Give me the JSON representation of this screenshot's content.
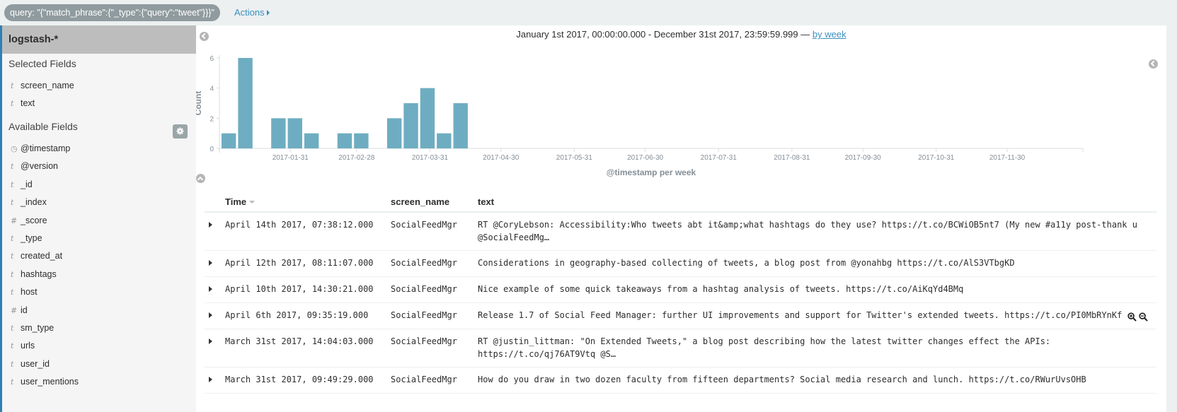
{
  "topbar": {
    "query_filter": "query: \"{\"match_phrase\":{\"_type\":{\"query\":\"tweet\"}}}\"",
    "actions_label": "Actions"
  },
  "sidebar": {
    "index_pattern": "logstash-*",
    "selected_title": "Selected Fields",
    "selected_fields": [
      {
        "type": "t",
        "name": "screen_name"
      },
      {
        "type": "t",
        "name": "text"
      }
    ],
    "available_title": "Available Fields",
    "available_fields": [
      {
        "type": "clock",
        "name": "@timestamp"
      },
      {
        "type": "t",
        "name": "@version"
      },
      {
        "type": "t",
        "name": "_id"
      },
      {
        "type": "t",
        "name": "_index"
      },
      {
        "type": "#",
        "name": "_score"
      },
      {
        "type": "t",
        "name": "_type"
      },
      {
        "type": "t",
        "name": "created_at"
      },
      {
        "type": "t",
        "name": "hashtags"
      },
      {
        "type": "t",
        "name": "host"
      },
      {
        "type": "#",
        "name": "id"
      },
      {
        "type": "t",
        "name": "sm_type"
      },
      {
        "type": "t",
        "name": "urls"
      },
      {
        "type": "t",
        "name": "user_id"
      },
      {
        "type": "t",
        "name": "user_mentions"
      }
    ]
  },
  "histogram": {
    "range_text": "January 1st 2017, 00:00:00.000 - December 31st 2017, 23:59:59.999 —",
    "interval_link": "by week"
  },
  "chart_data": {
    "type": "bar",
    "title": "",
    "xlabel": "@timestamp per week",
    "ylabel": "Count",
    "ylim": [
      0,
      6
    ],
    "yticks": [
      0,
      2,
      4,
      6
    ],
    "xrange": [
      "2017-01-01",
      "2017-12-31"
    ],
    "xtick_labels": [
      "2017-01-31",
      "2017-02-28",
      "2017-03-31",
      "2017-04-30",
      "2017-05-31",
      "2017-06-30",
      "2017-07-31",
      "2017-08-31",
      "2017-09-30",
      "2017-10-31",
      "2017-11-30"
    ],
    "categories": [
      "2017-01-01",
      "2017-01-08",
      "2017-01-15",
      "2017-01-22",
      "2017-01-29",
      "2017-02-05",
      "2017-02-12",
      "2017-02-19",
      "2017-02-26",
      "2017-03-05",
      "2017-03-12",
      "2017-03-19",
      "2017-03-26",
      "2017-04-02",
      "2017-04-09"
    ],
    "values": [
      1,
      6,
      0,
      2,
      2,
      1,
      0,
      1,
      1,
      0,
      2,
      3,
      4,
      1,
      3
    ],
    "bar_color": "#6eadc1",
    "grid": false
  },
  "table": {
    "columns": [
      "Time",
      "screen_name",
      "text"
    ],
    "rows": [
      {
        "time": "April 14th 2017, 07:38:12.000",
        "screen_name": "SocialFeedMgr",
        "text": "RT @CoryLebson: Accessibility:Who tweets abt it&amp;what hashtags do they use? https://t.co/BCWiOB5nt7 (My new #a11y post-thank u\n@SocialFeedMg…"
      },
      {
        "time": "April 12th 2017, 08:11:07.000",
        "screen_name": "SocialFeedMgr",
        "text": "Considerations in geography-based collecting of tweets, a blog post from @yonahbg https://t.co/AlS3VTbgKD"
      },
      {
        "time": "April 10th 2017, 14:30:21.000",
        "screen_name": "SocialFeedMgr",
        "text": "Nice example of some quick takeaways from a hashtag analysis of tweets. https://t.co/AiKqYd4BMq"
      },
      {
        "time": "April 6th 2017, 09:35:19.000",
        "screen_name": "SocialFeedMgr",
        "text": "Release 1.7 of Social Feed Manager: further UI improvements and support for Twitter's extended tweets. https://t.co/PI0MbRYnKf"
      },
      {
        "time": "March 31st 2017, 14:04:03.000",
        "screen_name": "SocialFeedMgr",
        "text": "RT @justin_littman: \"On Extended Tweets,\" a blog post describing how the latest twitter changes effect the APIs:\nhttps://t.co/qj76AT9Vtq @S…"
      },
      {
        "time": "March 31st 2017, 09:49:29.000",
        "screen_name": "SocialFeedMgr",
        "text": "How do you draw in two dozen faculty from fifteen departments? Social media research and lunch. https://t.co/RWurUvsOHB"
      }
    ]
  }
}
